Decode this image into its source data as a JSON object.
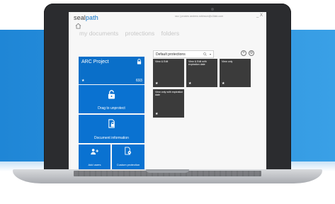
{
  "app": {
    "brand_prefix": "seal",
    "brand_suffix": "path",
    "top_links": "sso  |  proxies          andrew.robinson@c3ilab.com",
    "window_controls": "_ X"
  },
  "nav": {
    "items": [
      "my documents",
      "protections",
      "folders"
    ]
  },
  "project": {
    "title": "ARC Project",
    "star": "★",
    "count": "693"
  },
  "actions": {
    "drag_unprotect": "Drag to unprotect",
    "document_information": "Document information",
    "add_users": "Add users",
    "custom_protection": "Custom protection"
  },
  "protections": {
    "dropdown_value": "Default protections",
    "add_symbol": "+",
    "settings_symbol": "⚙",
    "tiles": [
      {
        "label": "View & Edit",
        "star": "★"
      },
      {
        "label": "View & Edit with expiration date",
        "star": "★"
      },
      {
        "label": "View only",
        "star": "★"
      },
      {
        "label": "View only with expiration date",
        "star": "★"
      }
    ]
  },
  "colors": {
    "accent_blue": "#0a72d1",
    "tile_dark": "#3b3b3b",
    "banner_blue": "#2b93df"
  },
  "icons": [
    "home-icon",
    "lock-icon",
    "unlock-icon",
    "document-info-icon",
    "add-users-icon",
    "custom-protection-icon",
    "search-icon",
    "add-icon",
    "settings-icon"
  ]
}
